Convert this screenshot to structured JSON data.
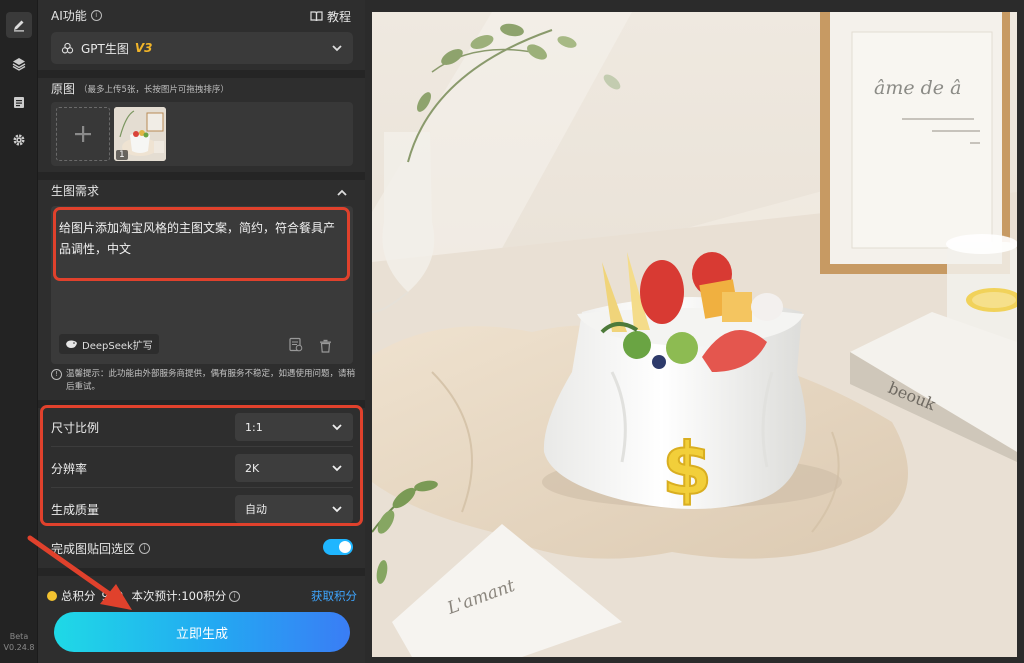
{
  "sidebar": {
    "version_label": "Beta",
    "version": "V0.24.8",
    "icons": [
      "edit-icon",
      "layers-icon",
      "clipboard-icon",
      "gear-icon"
    ]
  },
  "ai_section": {
    "title": "AI功能",
    "tutorial_label": "教程",
    "model_name": "GPT生图",
    "model_version": "V3"
  },
  "original": {
    "title": "原图",
    "hint": "（最多上传5张，长按图片可拖拽排序）",
    "thumb_count": "1"
  },
  "prompt": {
    "title": "生图需求",
    "text": "给图片添加淘宝风格的主图文案，简约，符合餐具产品调性，中文",
    "deepseek_label": "DeepSeek扩写"
  },
  "tip": {
    "text": "温馨提示：此功能由外部服务商提供，偶有服务不稳定，如遇使用问题，请稍后重试。"
  },
  "options": [
    {
      "label": "尺寸比例",
      "value": "1:1"
    },
    {
      "label": "分辨率",
      "value": "2K"
    },
    {
      "label": "生成质量",
      "value": "自动"
    }
  ],
  "paste_back": {
    "label": "完成图贴回选区",
    "enabled": true
  },
  "points": {
    "total_label": "总积分",
    "total_value": "969",
    "estimate": "本次预计:100积分",
    "get_label": "获取积分"
  },
  "generate_label": "立即生成",
  "photo": {
    "frame_title": "âme de â",
    "book_title": "beouk",
    "card_title": "L'amant"
  },
  "colors": {
    "accent": "#1fb6ff",
    "highlight_frame": "#e0412c",
    "model_version": "#f0b429"
  }
}
